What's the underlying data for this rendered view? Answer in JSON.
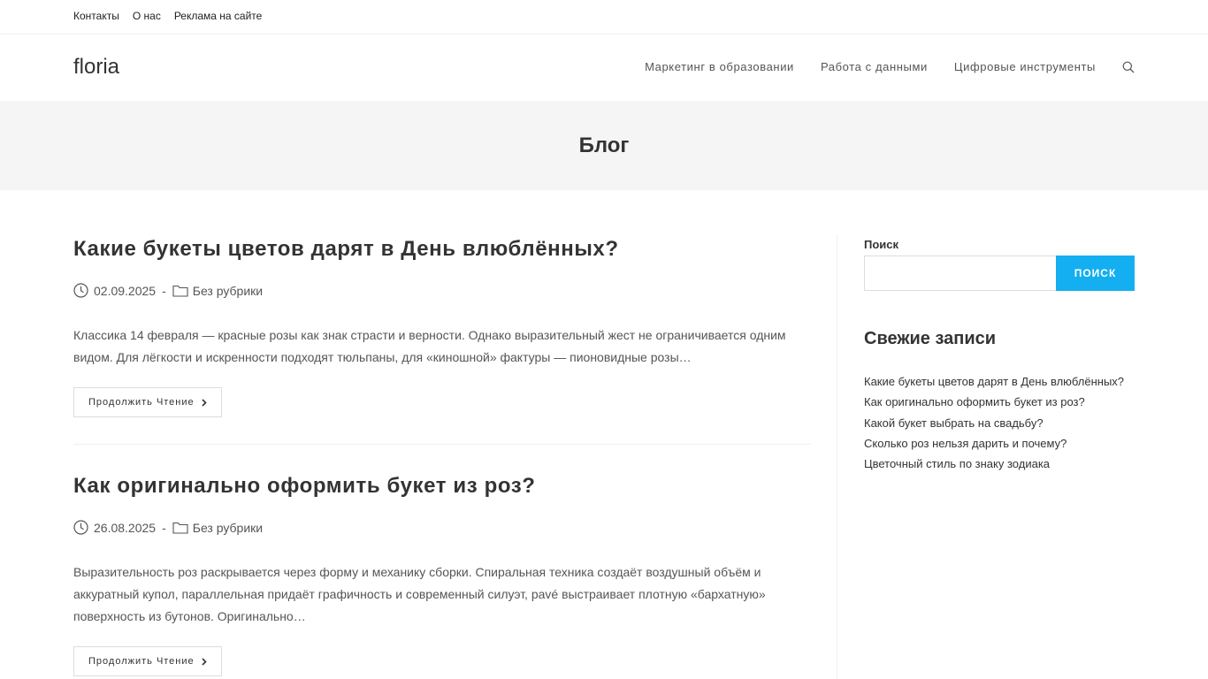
{
  "topbar": {
    "links": [
      "Контакты",
      "О нас",
      "Реклама на сайте"
    ]
  },
  "header": {
    "logo": "floria",
    "nav": [
      "Маркетинг в образовании",
      "Работа с данными",
      "Цифровые инструменты"
    ],
    "search_icon": "search-icon"
  },
  "page_header": {
    "title": "Блог"
  },
  "posts": [
    {
      "title": "Какие букеты цветов дарят в День влюблённых?",
      "date": "02.09.2025",
      "separator": "-",
      "category": "Без рубрики",
      "excerpt": "Классика 14 февраля — красные розы как знак страсти и верности. Однако выразительный жест не ограничивается одним видом. Для лёгкости и искренности подходят тюльпаны, для «киношной» фактуры — пионовидные розы…",
      "read_more": "Продолжить Чтение"
    },
    {
      "title": "Как оригинально оформить букет из роз?",
      "date": "26.08.2025",
      "separator": "-",
      "category": "Без рубрики",
      "excerpt": "Выразительность роз раскрывается через форму и механику сборки. Спиральная техника создаёт воздушный объём и аккуратный купол, параллельная придаёт графичность и современный силуэт, pavé выстраивает плотную «бархатную» поверхность из бутонов. Оригинально…",
      "read_more": "Продолжить Чтение"
    }
  ],
  "sidebar": {
    "search_label": "Поиск",
    "search_value": "",
    "search_button": "ПОИСК",
    "recent_title": "Свежие записи",
    "recent": [
      "Какие букеты цветов дарят в День влюблённых?",
      "Как оригинально оформить букет из роз?",
      "Какой букет выбрать на свадьбу?",
      "Сколько роз нельзя дарить и почему?",
      "Цветочный стиль по знаку зодиака"
    ]
  },
  "colors": {
    "accent": "#13aff0",
    "page_header_bg": "#f5f5f5",
    "text": "#333333"
  }
}
